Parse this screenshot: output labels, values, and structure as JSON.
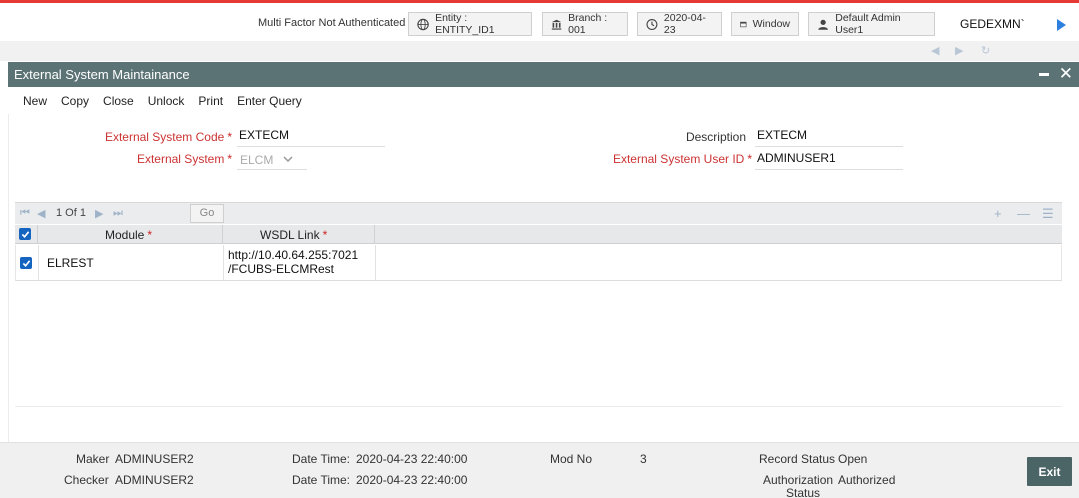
{
  "header": {
    "mfa_status": "Multi Factor Not Authenticated",
    "entity": "Entity : ENTITY_ID1",
    "branch": "Branch : 001",
    "date": "2020-04-23",
    "window": "Window",
    "user": "Default Admin User1",
    "user_id": "GEDEXMN`"
  },
  "window": {
    "title": "External System Maintainance"
  },
  "menu": [
    "New",
    "Copy",
    "Close",
    "Unlock",
    "Print",
    "Enter Query"
  ],
  "form": {
    "external_system_code_label": "External System Code",
    "external_system_code": "EXTECM",
    "external_system_label": "External System",
    "external_system": "ELCM",
    "description_label": "Description",
    "description": "EXTECM",
    "external_system_user_id_label": "External System User ID",
    "external_system_user_id": "ADMINUSER1"
  },
  "grid": {
    "pager_text": "1 Of 1",
    "go_label": "Go",
    "columns": [
      "Module",
      "WSDL Link"
    ],
    "rows": [
      {
        "module": "ELREST",
        "wsdl_link_line1": "http://10.40.64.255:7021",
        "wsdl_link_line2": "/FCUBS-ELCMRest"
      }
    ]
  },
  "footer": {
    "maker_label": "Maker",
    "maker": "ADMINUSER2",
    "checker_label": "Checker",
    "checker": "ADMINUSER2",
    "maker_datetime_label": "Date Time:",
    "maker_datetime": "2020-04-23 22:40:00",
    "checker_datetime_label": "Date Time:",
    "checker_datetime": "2020-04-23 22:40:00",
    "mod_no_label": "Mod No",
    "mod_no": "3",
    "record_status_label": "Record Status",
    "record_status": "Open",
    "authorization_status_label_1": "Authorization",
    "authorization_status_label_2": "Status",
    "authorization_status": "Authorized",
    "exit_label": "Exit"
  },
  "colors": {
    "accent_red": "#e53935",
    "title_bar": "#5c7376",
    "checkbox_blue": "#1565c0",
    "exit_button": "#4b6466"
  }
}
